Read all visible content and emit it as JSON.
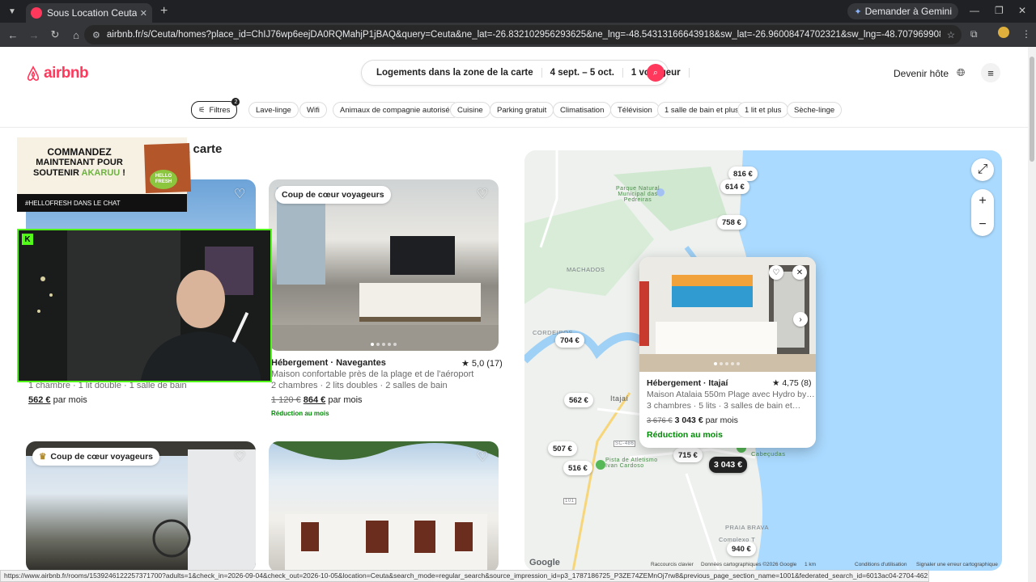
{
  "browser": {
    "tab_title": "Sous Location Ceuta, Location d…",
    "tab_close": "✕",
    "new_tab": "+",
    "gemini_label": "Demander à Gemini",
    "url": "airbnb.fr/s/Ceuta/homes?place_id=ChIJ76wp6eejDA0RQMahjP1jBAQ&query=Ceuta&ne_lat=-26.832102956293625&ne_lng=-48.54313166643918&sw_lat=-26.96008474702321&sw_lng=-48.70796990813648&refinement_paths%5B%5D=%2Fhomes...",
    "status_url": "https://www.airbnb.fr/rooms/1539246122257371700?adults=1&check_in=2026-09-04&check_out=2026-10-05&location=Ceuta&search_mode=regular_search&source_impression_id=p3_1787186725_P3ZE74ZEMnOj7rw8&previous_page_section_name=1001&federated_search_id=6013ac04-2704-4621-a543-699409c59e20"
  },
  "header": {
    "logo_text": "airbnb",
    "search_location": "Logements dans la zone de la carte",
    "search_dates": "4 sept. – 5 oct.",
    "search_guests": "1 voyageur",
    "become_host": "Devenir hôte"
  },
  "filters": {
    "filter_label": "Filtres",
    "filter_count": "2",
    "chips": [
      "Lave-linge",
      "Wifi",
      "Animaux de compagnie autorisés",
      "Cuisine",
      "Parking gratuit",
      "Climatisation",
      "Télévision",
      "1 salle de bain et plus",
      "1 lit et plus",
      "Sèche-linge"
    ]
  },
  "results_title_partial": "a carte",
  "listings": [
    {
      "details": "1 chambre · 1 lit double · 1 salle de bain",
      "price": "562 €",
      "price_suffix": "par mois"
    },
    {
      "badge": "Coup de cœur voyageurs",
      "title": "Hébergement · Navegantes",
      "rating": "★ 5,0 (17)",
      "description": "Maison confortable près de la plage et de l'aéroport",
      "details": "2 chambres · 2 lits doubles · 2 salles de bain",
      "old_price": "1 120 €",
      "price": "864 €",
      "price_suffix": "par mois",
      "promo": "Réduction au mois"
    },
    {
      "badge": "Coup de cœur voyageurs"
    },
    {}
  ],
  "ad": {
    "line1": "COMMANDEZ",
    "line2": "MAINTENANT POUR",
    "line3": "SOUTENIR",
    "accent": "AKARUU",
    "line3_end": "!",
    "cta": "#HELLOFRESH DANS LE CHAT",
    "brand": "HELLO FRESH"
  },
  "stream_overlay": {
    "badge": "K"
  },
  "map": {
    "pins": [
      "816 €",
      "614 €",
      "758 €",
      "704 €",
      "562 €",
      "507 €",
      "516 €",
      "715 €",
      "3 043 €",
      "940 €"
    ],
    "places": [
      "MACHADOS",
      "CORDEIROS",
      "Itajaí",
      "PRAIA BRAVA",
      "Complexo T",
      "Parque Natural Municipal das Pedreiras",
      "Pista de Atletismo Ivan Cardoso",
      "SC-486",
      "101",
      "Cabeçudas"
    ],
    "popup": {
      "title": "Hébergement · Itajaí",
      "rating": "★ 4,75 (8)",
      "description": "Maison Atalaia 550m Plage avec Hydro by…",
      "details": "3 chambres · 5 lits · 3 salles de bain et…",
      "old_price": "3 676 €",
      "price": "3 043 €",
      "price_suffix": "par mois",
      "promo": "Réduction au mois"
    },
    "google": "Google",
    "footer_shortcuts": "Raccourcis clavier",
    "footer_data": "Données cartographiques ©2026 Google",
    "footer_scale": "1 km",
    "footer_terms": "Conditions d'utilisation",
    "footer_report": "Signaler une erreur cartographique"
  },
  "colors": {
    "brand": "#ff385c",
    "stream_border": "#53fc18",
    "promo": "#008a05"
  }
}
